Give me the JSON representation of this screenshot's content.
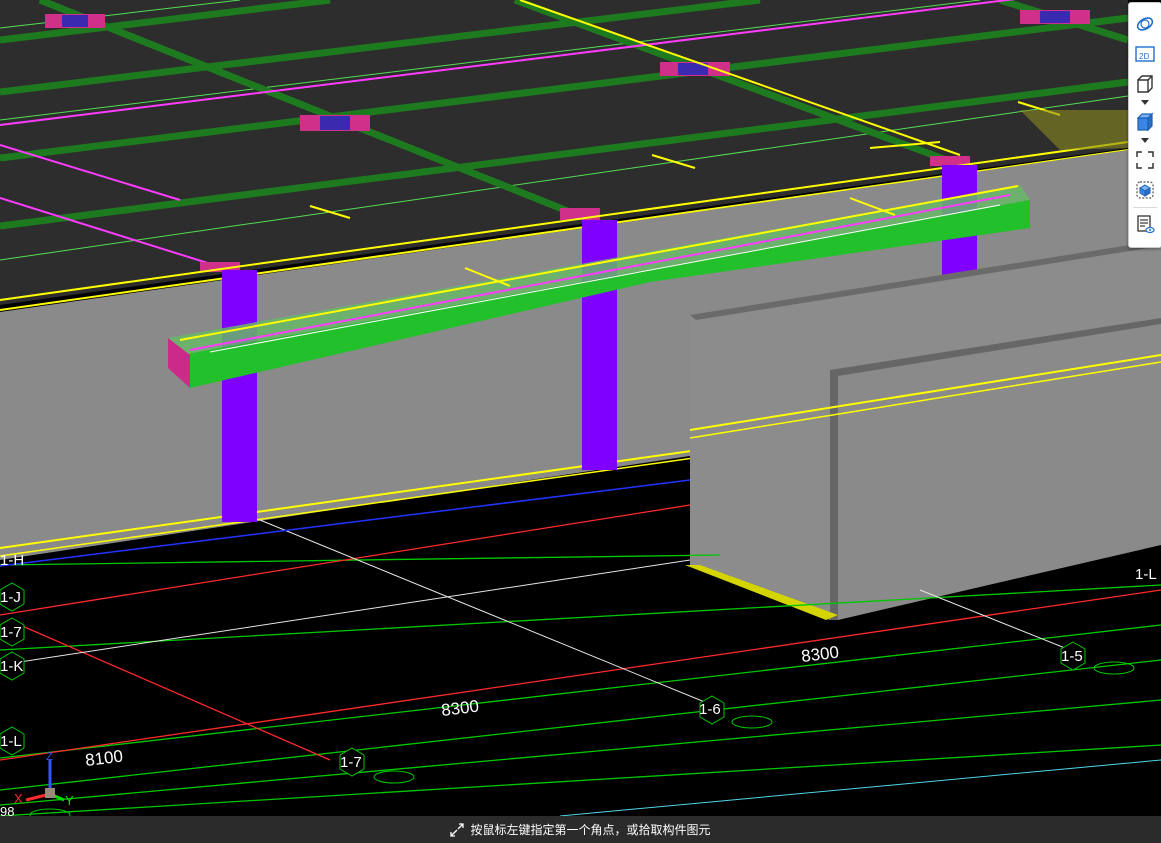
{
  "status_bar": {
    "prompt": "按鼠标左键指定第一个角点，或拾取构件图元"
  },
  "toolbar": {
    "buttons": [
      {
        "id": "dynamic-observe",
        "icon": "orbit-icon"
      },
      {
        "id": "2d-view",
        "icon": "2d-view-icon",
        "label": "2D"
      },
      {
        "id": "3d-view",
        "icon": "3d-box-icon"
      },
      {
        "id": "display-mode",
        "icon": "shaded-box-icon"
      },
      {
        "id": "full-screen",
        "icon": "fullscreen-icon"
      },
      {
        "id": "view-reset",
        "icon": "home-view-icon"
      },
      {
        "id": "display-settings",
        "icon": "display-settings-icon"
      }
    ]
  },
  "axes": {
    "row_labels": [
      "1-H",
      "1-J",
      "1-7",
      "1-K",
      "1-L"
    ],
    "column_labels": [
      "1-5",
      "1-6",
      "1-7"
    ],
    "right_label": "1-L",
    "dimensions": [
      "8100",
      "8300",
      "8300"
    ],
    "corner_number": "98"
  },
  "axis_indicator": {
    "x": "X",
    "y": "Y",
    "z": "Z"
  },
  "colors": {
    "slab": "#2d2d2d",
    "beam_green": "#1e7a1e",
    "beam_bright": "#22c02a",
    "column": "#7f00ff",
    "wall": "#808080",
    "axis_red": "#ff2a2a",
    "axis_green": "#00c800",
    "axis_yellow": "#ffff00",
    "axis_magenta": "#ff3cff",
    "background": "#000000",
    "status_bg": "#2b2b2b"
  }
}
